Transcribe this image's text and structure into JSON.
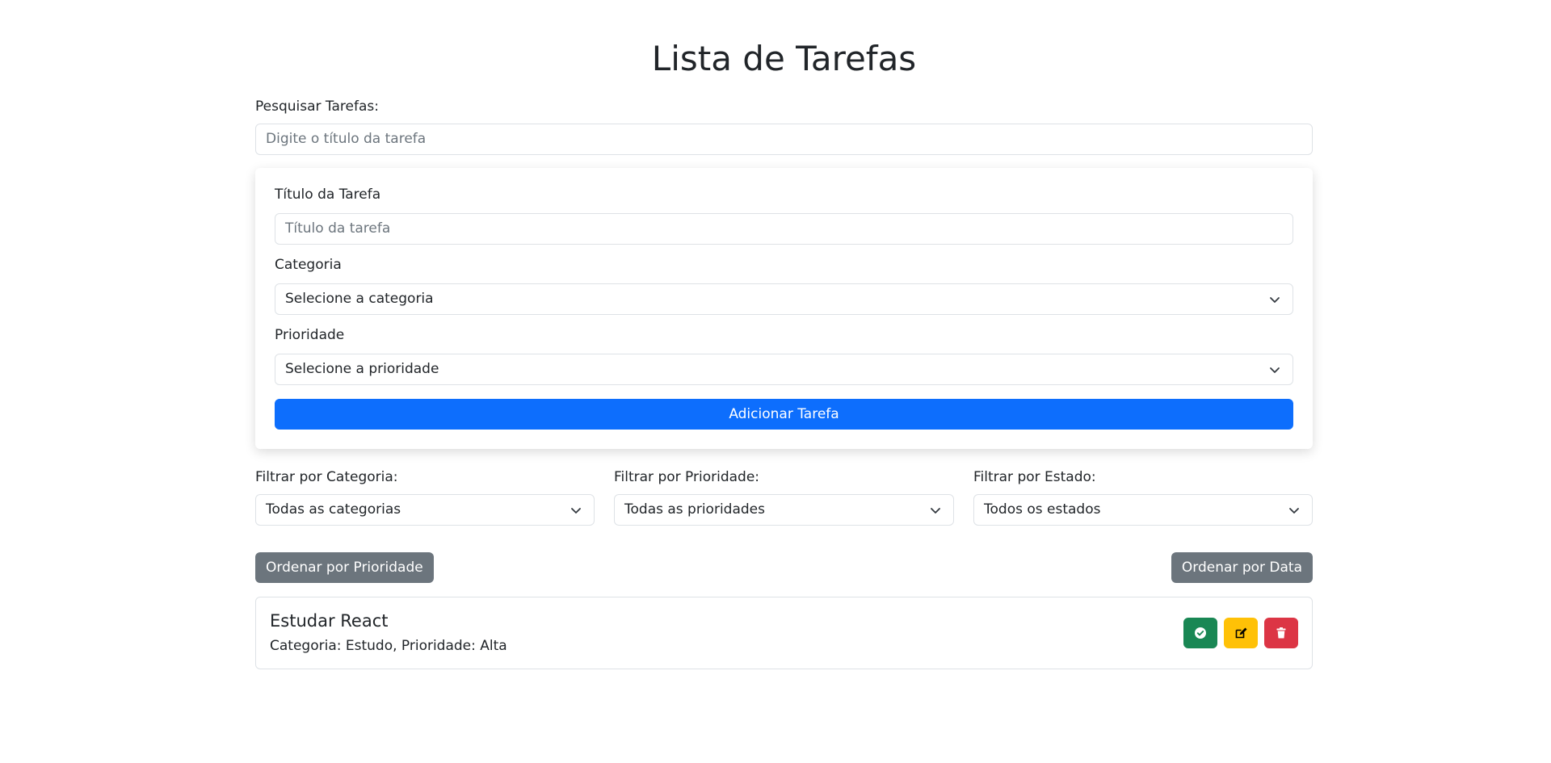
{
  "page": {
    "title": "Lista de Tarefas"
  },
  "search": {
    "label": "Pesquisar Tarefas:",
    "placeholder": "Digite o título da tarefa"
  },
  "form": {
    "title_label": "Título da Tarefa",
    "title_placeholder": "Título da tarefa",
    "category_label": "Categoria",
    "category_value": "Selecione a categoria",
    "priority_label": "Prioridade",
    "priority_value": "Selecione a prioridade",
    "submit_label": "Adicionar Tarefa"
  },
  "filters": {
    "category": {
      "label": "Filtrar por Categoria:",
      "value": "Todas as categorias"
    },
    "priority": {
      "label": "Filtrar por Prioridade:",
      "value": "Todas as prioridades"
    },
    "state": {
      "label": "Filtrar por Estado:",
      "value": "Todos os estados"
    }
  },
  "sort": {
    "by_priority": "Ordenar por Prioridade",
    "by_date": "Ordenar por Data"
  },
  "tasks": [
    {
      "title": "Estudar React",
      "meta": "Categoria: Estudo, Prioridade: Alta"
    }
  ],
  "colors": {
    "primary": "#0d6efd",
    "secondary": "#6c757d",
    "success": "#198754",
    "warning": "#ffc107",
    "danger": "#dc3545"
  },
  "icons": {
    "complete": "check-circle-icon",
    "edit": "edit-icon",
    "delete": "trash-icon"
  }
}
